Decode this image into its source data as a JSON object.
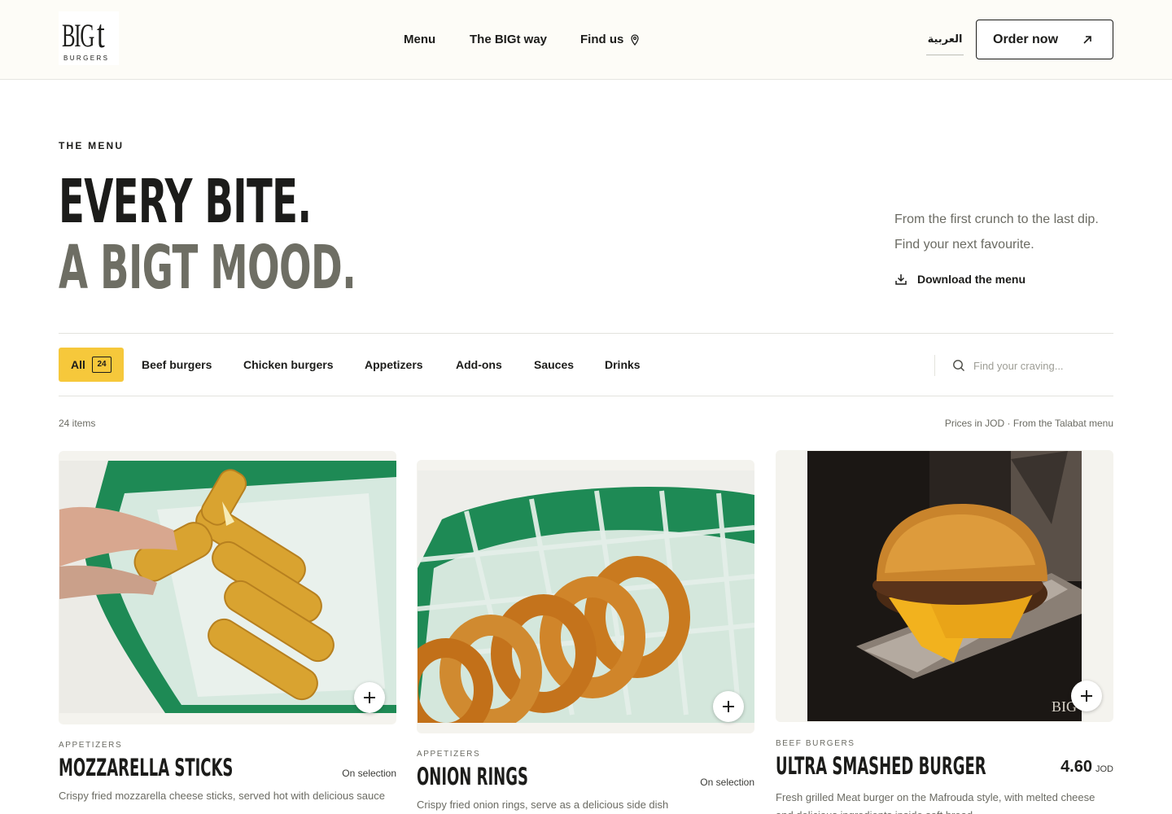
{
  "brand": {
    "logo_big": "BIG",
    "logo_t": "t",
    "logo_sub": "BURGERS"
  },
  "nav": {
    "items": [
      {
        "label": "Menu"
      },
      {
        "label": "The BIGt way"
      },
      {
        "label": "Find us",
        "icon": "map-pin-icon"
      }
    ],
    "language": "العربية",
    "order_label": "Order now",
    "order_icon": "arrow-up-right-icon"
  },
  "hero": {
    "eyebrow": "THE MENU",
    "headline_line1": "EVERY BITE.",
    "headline_line2": "A BIGT MOOD.",
    "tagline_line1": "From the first crunch to the last dip.",
    "tagline_line2": "Find your next favourite.",
    "download_label": "Download the menu",
    "download_icon": "download-icon"
  },
  "filters": {
    "all_label": "All",
    "all_count": "24",
    "categories": [
      "Beef burgers",
      "Chicken burgers",
      "Appetizers",
      "Add-ons",
      "Sauces",
      "Drinks"
    ],
    "search_placeholder": "Find your craving...",
    "search_icon": "search-icon",
    "active": "All"
  },
  "list_meta": {
    "count_label": "24 items",
    "prices_note": "Prices in JOD · From the Talabat menu"
  },
  "items": [
    {
      "category": "APPETIZERS",
      "name": "MOZZARELLA STICKS",
      "price_note": "On selection",
      "description": "Crispy fried mozzarella cheese sticks, served hot with delicious sauce"
    },
    {
      "category": "APPETIZERS",
      "name": "ONION RINGS",
      "price_note": "On selection",
      "description": "Crispy fried onion rings, serve as a delicious side dish"
    },
    {
      "category": "BEEF BURGERS",
      "name": "ULTRA SMASHED BURGER",
      "price": "4.60",
      "currency": "JOD",
      "description": "Fresh grilled Meat burger on the Mafrouda style, with melted cheese and delicious ingredients inside soft bread"
    }
  ],
  "colors": {
    "accent": "#f6c83b",
    "text": "#1c1c1a",
    "muted": "#6b6b63",
    "header_bg": "#fdfcf7",
    "basket_green": "#1e8a55"
  }
}
